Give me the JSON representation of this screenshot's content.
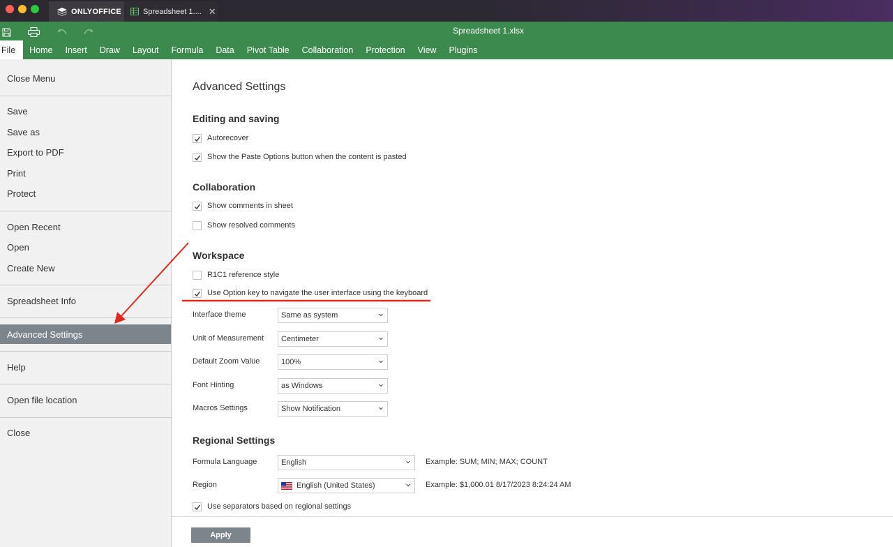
{
  "window": {
    "app_name": "ONLYOFFICE",
    "doc_tab_label": "Spreadsheet 1....",
    "doc_tab_close": "✕",
    "doc_title": "Spreadsheet 1.xlsx"
  },
  "menu": {
    "items": [
      "File",
      "Home",
      "Insert",
      "Draw",
      "Layout",
      "Formula",
      "Data",
      "Pivot Table",
      "Collaboration",
      "Protection",
      "View",
      "Plugins"
    ],
    "active": "File"
  },
  "sidebar": {
    "close_menu": "Close Menu",
    "save": "Save",
    "save_as": "Save as",
    "export_pdf": "Export to PDF",
    "print": "Print",
    "protect": "Protect",
    "open_recent": "Open Recent",
    "open": "Open",
    "create_new": "Create New",
    "spreadsheet_info": "Spreadsheet Info",
    "advanced_settings": "Advanced Settings",
    "help": "Help",
    "open_file_location": "Open file location",
    "close": "Close",
    "selected": "Advanced Settings"
  },
  "settings": {
    "title": "Advanced Settings",
    "editing": {
      "heading": "Editing and saving",
      "autorecover": {
        "label": "Autorecover",
        "checked": true
      },
      "paste_options": {
        "label": "Show the Paste Options button when the content is pasted",
        "checked": true
      }
    },
    "collaboration": {
      "heading": "Collaboration",
      "show_comments": {
        "label": "Show comments in sheet",
        "checked": true
      },
      "show_resolved": {
        "label": "Show resolved comments",
        "checked": false
      }
    },
    "workspace": {
      "heading": "Workspace",
      "r1c1": {
        "label": "R1C1 reference style",
        "checked": false
      },
      "option_key": {
        "label": "Use Option key to navigate the user interface using the keyboard",
        "checked": true
      },
      "interface_theme": {
        "label": "Interface theme",
        "value": "Same as system"
      },
      "unit": {
        "label": "Unit of Measurement",
        "value": "Centimeter"
      },
      "zoom": {
        "label": "Default Zoom Value",
        "value": "100%"
      },
      "font_hinting": {
        "label": "Font Hinting",
        "value": "as Windows"
      },
      "macros": {
        "label": "Macros Settings",
        "value": "Show Notification"
      }
    },
    "regional": {
      "heading": "Regional Settings",
      "formula_language": {
        "label": "Formula Language",
        "value": "English",
        "example": "Example: SUM; MIN; MAX; COUNT"
      },
      "region": {
        "label": "Region",
        "value": "English (United States)",
        "example": "Example: $1,000.01 8/17/2023 8:24:24 AM"
      },
      "separators": {
        "label": "Use separators based on regional settings",
        "checked": true
      }
    },
    "apply_label": "Apply"
  },
  "colors": {
    "toolbar_green": "#3d8a4e",
    "selected_gray": "#7d858c",
    "annotation_red": "#e0281e"
  },
  "icons": [
    "save-icon",
    "print-icon",
    "undo-icon",
    "redo-icon",
    "onlyoffice-logo-icon",
    "spreadsheet-icon",
    "close-icon",
    "checkmark-icon",
    "chevron-down-icon",
    "us-flag-icon"
  ]
}
